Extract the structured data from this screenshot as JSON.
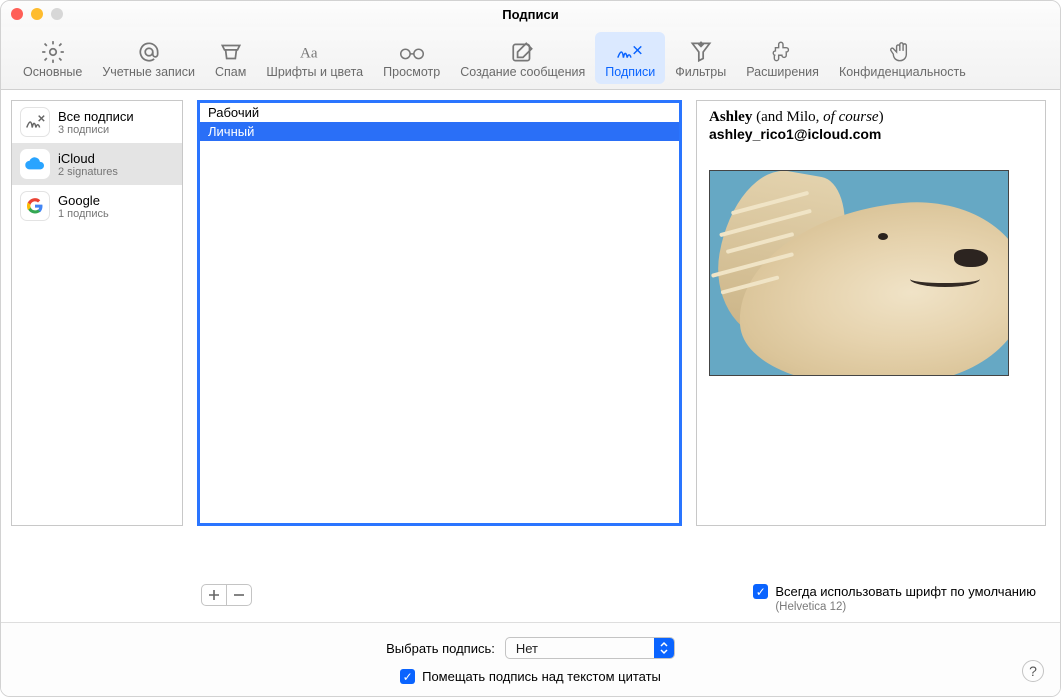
{
  "window": {
    "title": "Подписи"
  },
  "toolbar": {
    "items": [
      {
        "label": "Основные"
      },
      {
        "label": "Учетные записи"
      },
      {
        "label": "Спам"
      },
      {
        "label": "Шрифты и цвета"
      },
      {
        "label": "Просмотр"
      },
      {
        "label": "Создание сообщения"
      },
      {
        "label": "Подписи"
      },
      {
        "label": "Фильтры"
      },
      {
        "label": "Расширения"
      },
      {
        "label": "Конфиденциальность"
      }
    ],
    "selected_index": 6
  },
  "accounts": [
    {
      "title": "Все подписи",
      "subtitle": "3 подписи"
    },
    {
      "title": "iCloud",
      "subtitle": "2 signatures"
    },
    {
      "title": "Google",
      "subtitle": "1 подпись"
    }
  ],
  "signatures": {
    "items": [
      {
        "name": "Рабочий"
      },
      {
        "name": "Личный"
      }
    ],
    "selected_index": 1
  },
  "preview": {
    "name_bold": "Ashley",
    "name_paren_plain": " (and Milo, ",
    "name_paren_italic": "of course",
    "name_paren_close": ")",
    "email": "ashley_rico1@icloud.com"
  },
  "always_default_font": {
    "checked": true,
    "label": "Всегда использовать шрифт по умолчанию",
    "hint": "(Helvetica 12)"
  },
  "choose_signature": {
    "label": "Выбрать подпись:",
    "value": "Нет"
  },
  "place_above": {
    "checked": true,
    "label": "Помещать подпись над текстом цитаты"
  }
}
